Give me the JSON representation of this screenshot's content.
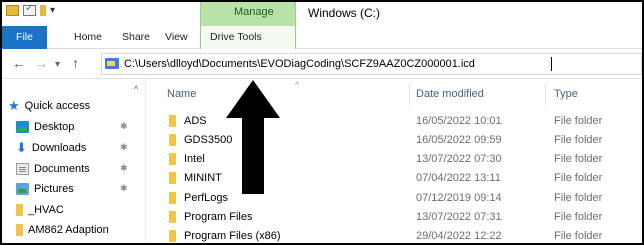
{
  "window": {
    "title": "Windows (C:)",
    "context_tab_group": "Manage",
    "colors": {
      "file_tab": "#1a73c4",
      "manage_tab": "#b9e3a6",
      "folder": "#f0c54a"
    }
  },
  "ribbon": {
    "tabs": [
      {
        "label": "File",
        "active": true
      },
      {
        "label": "Home"
      },
      {
        "label": "Share"
      },
      {
        "label": "View"
      },
      {
        "label": "Drive Tools"
      }
    ]
  },
  "nav": {
    "back_icon": "arrow-left-icon",
    "forward_icon": "arrow-right-icon",
    "recent_icon": "chevron-down-icon",
    "up_icon": "arrow-up-icon"
  },
  "address": {
    "path": "C:\\Users\\dlloyd\\Documents\\EVODiagCoding\\SCFZ9AAZ0CZ000001.icd"
  },
  "sidebar": {
    "quick_access": "Quick access",
    "items": [
      {
        "label": "Desktop",
        "icon": "desktop-icon",
        "pinned": true
      },
      {
        "label": "Downloads",
        "icon": "download-icon",
        "pinned": true
      },
      {
        "label": "Documents",
        "icon": "documents-icon",
        "pinned": true
      },
      {
        "label": "Pictures",
        "icon": "pictures-icon",
        "pinned": true
      },
      {
        "label": "_HVAC",
        "icon": "folder-icon",
        "pinned": false
      },
      {
        "label": "AM862 Adaption",
        "icon": "folder-icon",
        "pinned": false
      }
    ]
  },
  "columns": {
    "name": "Name",
    "date": "Date modified",
    "type": "Type"
  },
  "files": [
    {
      "name": "ADS",
      "date": "16/05/2022 10:01",
      "type": "File folder"
    },
    {
      "name": "GDS3500",
      "date": "16/05/2022 09:59",
      "type": "File folder"
    },
    {
      "name": "Intel",
      "date": "13/07/2022 07:30",
      "type": "File folder"
    },
    {
      "name": "MININT",
      "date": "07/04/2022 13:11",
      "type": "File folder"
    },
    {
      "name": "PerfLogs",
      "date": "07/12/2019 09:14",
      "type": "File folder"
    },
    {
      "name": "Program Files",
      "date": "13/07/2022 07:31",
      "type": "File folder"
    },
    {
      "name": "Program Files (x86)",
      "date": "29/04/2022 12:22",
      "type": "File folder"
    }
  ]
}
